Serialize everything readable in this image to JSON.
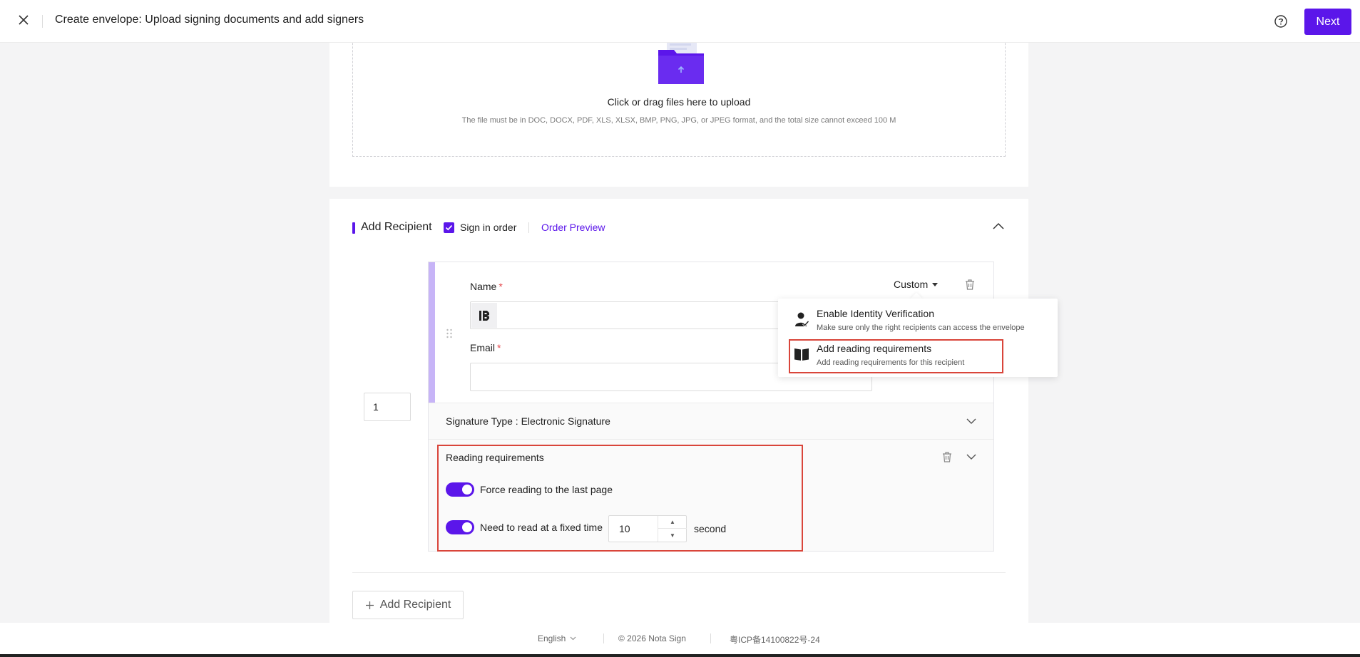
{
  "header": {
    "title": "Create envelope: Upload signing documents and add signers",
    "next_label": "Next"
  },
  "upload": {
    "title": "Click or drag files here to upload",
    "hint": "The file must be in DOC, DOCX, PDF, XLS, XLSX, BMP, PNG, JPG, or JPEG format, and the total size cannot exceed 100 M"
  },
  "recipient_section": {
    "title": "Add Recipient",
    "sign_in_order_label": "Sign in order",
    "sign_in_order_checked": true,
    "order_preview_label": "Order Preview",
    "add_recipient_label": "Add Recipient"
  },
  "recipient": {
    "order": "1",
    "name_label": "Name",
    "email_label": "Email",
    "required_mark": "*",
    "custom_label": "Custom",
    "signature_type_label": "Signature Type : Electronic Signature",
    "reading": {
      "title": "Reading requirements",
      "force_last_page_label": "Force reading to the last page",
      "force_last_page_on": true,
      "fixed_time_label": "Need to read at a fixed time",
      "fixed_time_on": true,
      "fixed_time_value": "10",
      "unit_label": "second"
    }
  },
  "custom_menu": {
    "items": [
      {
        "title": "Enable Identity Verification",
        "desc": "Make sure only the right recipients can access the envelope",
        "icon": "identity-verify-icon"
      },
      {
        "title": "Add reading requirements",
        "desc": "Add reading requirements for this recipient",
        "icon": "book-icon"
      }
    ]
  },
  "footer": {
    "language": "English",
    "copyright": "© 2026 Nota Sign",
    "icp": "粤ICP备14100822号-24"
  },
  "colors": {
    "accent": "#5b16ea",
    "highlight": "#d9453a",
    "bar": "#c7b4f7"
  }
}
